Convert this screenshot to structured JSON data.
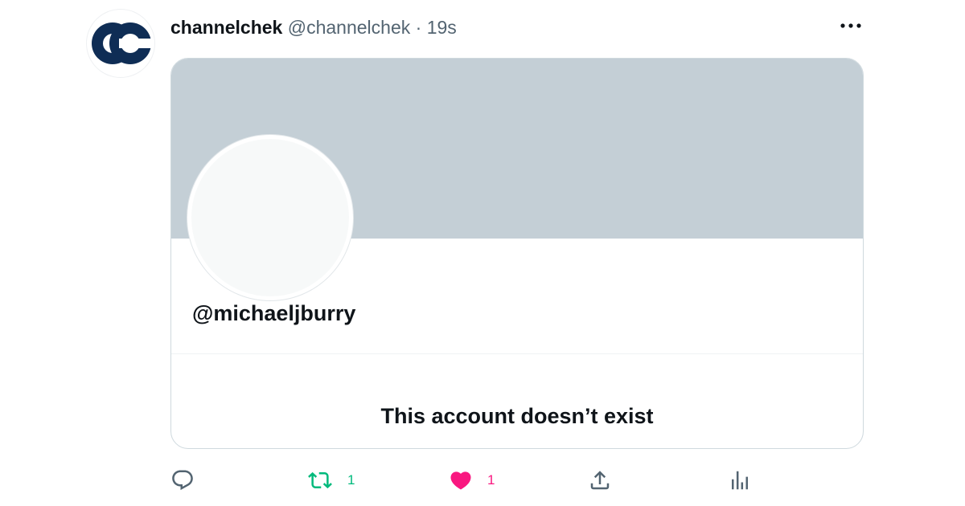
{
  "author": {
    "display_name": "channelchek",
    "handle": "@channelchek",
    "separator": "·",
    "time": "19s",
    "avatar_icon": "channelchek-logo"
  },
  "more_icon": "more-dots-icon",
  "card": {
    "banner_color": "#c4cfd6",
    "profile_handle": "@michaeljburry",
    "message": "This account doesn’t exist"
  },
  "actions": {
    "reply": {
      "icon": "reply-icon",
      "count": ""
    },
    "retweet": {
      "icon": "retweet-icon",
      "count": "1",
      "active_color": "#00ba7c"
    },
    "like": {
      "icon": "heart-icon",
      "count": "1",
      "active_color": "#f91880"
    },
    "share": {
      "icon": "share-icon"
    },
    "views": {
      "icon": "views-icon"
    }
  }
}
